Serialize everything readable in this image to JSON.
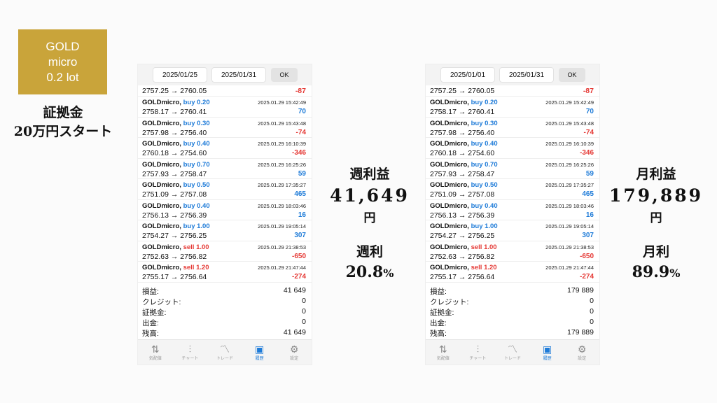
{
  "badge": {
    "line1": "GOLD",
    "line2": "micro",
    "line3": "0.2 lot"
  },
  "start": {
    "line1": "証拠金",
    "line2": "20万円スタート"
  },
  "weekly": {
    "label": "週利益",
    "amount": "41,649",
    "unit": "円",
    "rate_label": "週利",
    "rate": "20.8",
    "pct": "%"
  },
  "monthly": {
    "label": "月利益",
    "amount": "179,889",
    "unit": "円",
    "rate_label": "月利",
    "rate": "89.9",
    "pct": "%"
  },
  "left": {
    "date_from": "2025/01/25",
    "date_to": "2025/01/31",
    "ok": "OK",
    "summary": {
      "pl": "41 649",
      "credit": "0",
      "deposit": "0",
      "withdraw": "0",
      "balance": "41 649"
    }
  },
  "right": {
    "date_from": "2025/01/01",
    "date_to": "2025/01/31",
    "ok": "OK",
    "summary": {
      "pl": "179 889",
      "credit": "0",
      "deposit": "0",
      "withdraw": "0",
      "balance": "179 889"
    }
  },
  "first_row": {
    "price": "2757.25 → 2760.05",
    "profit": "-87"
  },
  "trades": [
    {
      "symbol": "GOLDmicro,",
      "side": "buy 0.20",
      "type": "buy",
      "time": "2025.01.29 15:42:49",
      "price": "2758.17 → 2760.41",
      "profit": "70",
      "sign": "pos"
    },
    {
      "symbol": "GOLDmicro,",
      "side": "buy 0.30",
      "type": "buy",
      "time": "2025.01.29 15:43:48",
      "price": "2757.98 → 2756.40",
      "profit": "-74",
      "sign": "neg"
    },
    {
      "symbol": "GOLDmicro,",
      "side": "buy 0.40",
      "type": "buy",
      "time": "2025.01.29 16:10:39",
      "price": "2760.18 → 2754.60",
      "profit": "-346",
      "sign": "neg"
    },
    {
      "symbol": "GOLDmicro,",
      "side": "buy 0.70",
      "type": "buy",
      "time": "2025.01.29 16:25:26",
      "price": "2757.93 → 2758.47",
      "profit": "59",
      "sign": "pos"
    },
    {
      "symbol": "GOLDmicro,",
      "side": "buy 0.50",
      "type": "buy",
      "time": "2025.01.29 17:35:27",
      "price": "2751.09 → 2757.08",
      "profit": "465",
      "sign": "pos"
    },
    {
      "symbol": "GOLDmicro,",
      "side": "buy 0.40",
      "type": "buy",
      "time": "2025.01.29 18:03:46",
      "price": "2756.13 → 2756.39",
      "profit": "16",
      "sign": "pos"
    },
    {
      "symbol": "GOLDmicro,",
      "side": "buy 1.00",
      "type": "buy",
      "time": "2025.01.29 19:05:14",
      "price": "2754.27 → 2756.25",
      "profit": "307",
      "sign": "pos"
    },
    {
      "symbol": "GOLDmicro,",
      "side": "sell 1.00",
      "type": "sell",
      "time": "2025.01.29 21:38:53",
      "price": "2752.63 → 2756.82",
      "profit": "-650",
      "sign": "neg"
    },
    {
      "symbol": "GOLDmicro,",
      "side": "sell 1.20",
      "type": "sell",
      "time": "2025.01.29 21:47:44",
      "price": "2755.17 → 2756.64",
      "profit": "-274",
      "sign": "neg"
    }
  ],
  "summary_labels": {
    "pl": "損益:",
    "credit": "クレジット:",
    "deposit": "証拠金:",
    "withdraw": "出金:",
    "balance": "残高:"
  },
  "tabs": [
    {
      "label": "気配値",
      "icon": "quotes-icon",
      "glyph": "⇅"
    },
    {
      "label": "チャート",
      "icon": "chart-icon",
      "glyph": "⫶"
    },
    {
      "label": "トレード",
      "icon": "trade-icon",
      "glyph": "〽"
    },
    {
      "label": "履歴",
      "icon": "history-icon",
      "glyph": "▣",
      "active": true
    },
    {
      "label": "設定",
      "icon": "settings-icon",
      "glyph": "⚙"
    }
  ],
  "colors": {
    "gold": "#c9a43a",
    "buy": "#1e7bd8",
    "sell": "#e53935"
  }
}
